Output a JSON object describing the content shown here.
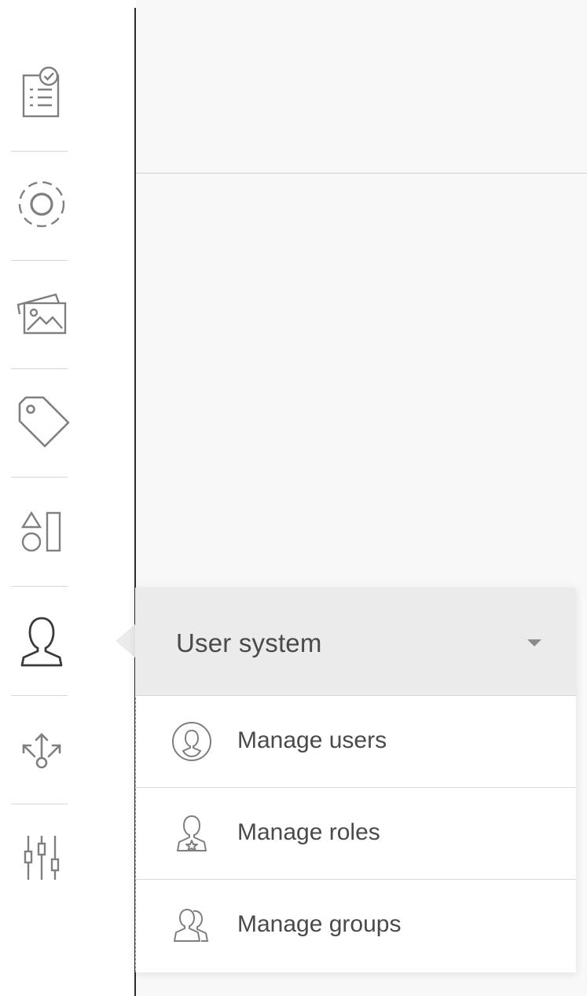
{
  "sidebar": {
    "items": [
      {
        "icon": "checklist-document-icon"
      },
      {
        "icon": "settings-circle-icon"
      },
      {
        "icon": "image-gallery-icon"
      },
      {
        "icon": "tag-icon"
      },
      {
        "icon": "shapes-icon"
      },
      {
        "icon": "user-icon"
      },
      {
        "icon": "share-arrows-icon"
      },
      {
        "icon": "sliders-icon"
      }
    ]
  },
  "user_menu": {
    "title": "User system",
    "items": [
      {
        "label": "Manage users",
        "icon": "user-circle-icon"
      },
      {
        "label": "Manage roles",
        "icon": "user-star-icon"
      },
      {
        "label": "Manage groups",
        "icon": "user-group-icon"
      }
    ]
  },
  "colors": {
    "icon_stroke": "#7f7f7f",
    "active_icon_stroke": "#3a3a3a",
    "flyout_header_bg": "#ebebeb",
    "main_bg": "#f8f8f8",
    "text": "#4a4a4a"
  }
}
